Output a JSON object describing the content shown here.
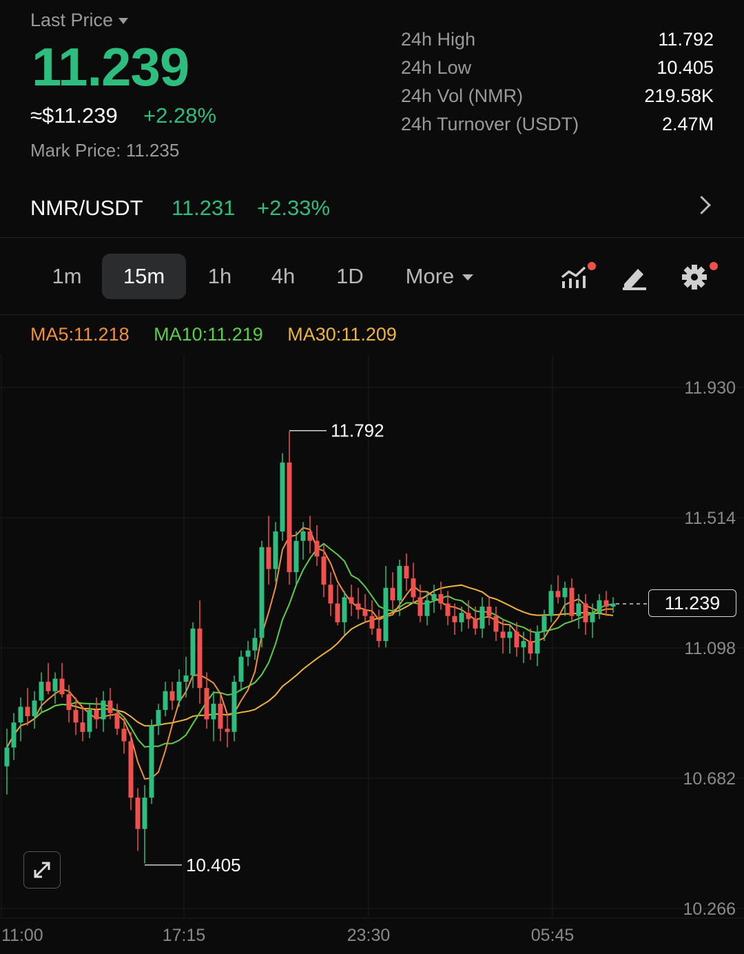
{
  "header": {
    "last_price_label": "Last Price",
    "last_price": "11.239",
    "usd_price": "≈$11.239",
    "change_pct": "+2.28%",
    "mark_price_label": "Mark Price:",
    "mark_price": "11.235"
  },
  "stats": [
    {
      "label": "24h High",
      "value": "11.792"
    },
    {
      "label": "24h Low",
      "value": "10.405"
    },
    {
      "label": "24h Vol (NMR)",
      "value": "219.58K"
    },
    {
      "label": "24h Turnover (USDT)",
      "value": "2.47M"
    }
  ],
  "pair": {
    "name": "NMR/USDT",
    "price": "11.231",
    "change": "+2.33%"
  },
  "timeframes": {
    "items": [
      "1m",
      "15m",
      "1h",
      "4h",
      "1D"
    ],
    "active": "15m",
    "more_label": "More"
  },
  "indicators": {
    "ma5": "MA5:11.218",
    "ma10": "MA10:11.219",
    "ma30": "MA30:11.209"
  },
  "colors": {
    "up": "#2dbd7e",
    "down": "#f0514d",
    "ma5": "#f0913a",
    "ma10": "#5ad04a",
    "ma30": "#f0b43a",
    "background": "#0b0b0b"
  },
  "icons": [
    "chart-indicator-icon",
    "draw-pen-icon",
    "settings-gear-icon",
    "expand-icon",
    "chevron-right-icon"
  ],
  "chart_data": {
    "type": "candlestick",
    "y_ticks": [
      "11.930",
      "11.514",
      "11.098",
      "10.682",
      "10.266"
    ],
    "x_ticks": [
      "11:00",
      "17:15",
      "23:30",
      "05:45"
    ],
    "ylim": [
      10.266,
      11.93
    ],
    "current_price": "11.239",
    "high_marker": "11.792",
    "low_marker": "10.405",
    "candles": [
      [
        10.72,
        10.84,
        10.63,
        10.78
      ],
      [
        10.78,
        10.89,
        10.74,
        10.86
      ],
      [
        10.86,
        10.94,
        10.8,
        10.91
      ],
      [
        10.91,
        10.97,
        10.85,
        10.88
      ],
      [
        10.88,
        10.96,
        10.84,
        10.93
      ],
      [
        10.93,
        11.02,
        10.89,
        10.99
      ],
      [
        10.99,
        11.05,
        10.95,
        10.96
      ],
      [
        10.96,
        11.02,
        10.92,
        11.0
      ],
      [
        11.0,
        11.05,
        10.94,
        10.95
      ],
      [
        10.95,
        10.98,
        10.86,
        10.9
      ],
      [
        10.9,
        10.94,
        10.82,
        10.86
      ],
      [
        10.86,
        10.91,
        10.8,
        10.83
      ],
      [
        10.83,
        10.92,
        10.81,
        10.9
      ],
      [
        10.9,
        10.94,
        10.84,
        10.87
      ],
      [
        10.87,
        10.96,
        10.83,
        10.93
      ],
      [
        10.93,
        10.97,
        10.87,
        10.89
      ],
      [
        10.89,
        10.92,
        10.82,
        10.84
      ],
      [
        10.84,
        10.88,
        10.76,
        10.8
      ],
      [
        10.8,
        10.83,
        10.58,
        10.62
      ],
      [
        10.62,
        10.65,
        10.45,
        10.52
      ],
      [
        10.52,
        10.66,
        10.41,
        10.62
      ],
      [
        10.62,
        10.87,
        10.6,
        10.85
      ],
      [
        10.85,
        10.92,
        10.82,
        10.9
      ],
      [
        10.9,
        10.99,
        10.88,
        10.96
      ],
      [
        10.96,
        10.99,
        10.9,
        10.93
      ],
      [
        10.93,
        11.03,
        10.91,
        10.99
      ],
      [
        10.99,
        11.07,
        10.94,
        11.01
      ],
      [
        11.01,
        11.18,
        10.97,
        11.16
      ],
      [
        11.16,
        11.25,
        10.92,
        10.97
      ],
      [
        10.97,
        11.02,
        10.84,
        10.87
      ],
      [
        10.87,
        10.96,
        10.8,
        10.92
      ],
      [
        10.92,
        10.95,
        10.8,
        10.84
      ],
      [
        10.84,
        10.89,
        10.78,
        10.83
      ],
      [
        10.83,
        11.01,
        10.8,
        10.99
      ],
      [
        10.99,
        11.09,
        10.96,
        11.07
      ],
      [
        11.07,
        11.12,
        11.04,
        11.09
      ],
      [
        11.09,
        11.16,
        11.06,
        11.13
      ],
      [
        11.13,
        11.44,
        11.1,
        11.42
      ],
      [
        11.42,
        11.52,
        11.3,
        11.35
      ],
      [
        11.35,
        11.5,
        11.31,
        11.47
      ],
      [
        11.47,
        11.72,
        11.44,
        11.69
      ],
      [
        11.69,
        11.79,
        11.3,
        11.34
      ],
      [
        11.34,
        11.47,
        11.3,
        11.44
      ],
      [
        11.44,
        11.5,
        11.38,
        11.47
      ],
      [
        11.47,
        11.52,
        11.4,
        11.44
      ],
      [
        11.44,
        11.49,
        11.36,
        11.39
      ],
      [
        11.39,
        11.43,
        11.26,
        11.3
      ],
      [
        11.3,
        11.34,
        11.2,
        11.24
      ],
      [
        11.24,
        11.3,
        11.17,
        11.18
      ],
      [
        11.18,
        11.28,
        11.14,
        11.26
      ],
      [
        11.26,
        11.3,
        11.2,
        11.24
      ],
      [
        11.24,
        11.29,
        11.19,
        11.22
      ],
      [
        11.22,
        11.27,
        11.18,
        11.2
      ],
      [
        11.2,
        11.25,
        11.14,
        11.16
      ],
      [
        11.16,
        11.22,
        11.1,
        11.12
      ],
      [
        11.12,
        11.36,
        11.1,
        11.29
      ],
      [
        11.29,
        11.34,
        11.22,
        11.25
      ],
      [
        11.25,
        11.38,
        11.2,
        11.36
      ],
      [
        11.36,
        11.4,
        11.28,
        11.32
      ],
      [
        11.32,
        11.37,
        11.24,
        11.26
      ],
      [
        11.26,
        11.3,
        11.18,
        11.2
      ],
      [
        11.2,
        11.28,
        11.17,
        11.25
      ],
      [
        11.25,
        11.3,
        11.21,
        11.27
      ],
      [
        11.27,
        11.31,
        11.22,
        11.24
      ],
      [
        11.24,
        11.28,
        11.17,
        11.2
      ],
      [
        11.2,
        11.24,
        11.14,
        11.18
      ],
      [
        11.18,
        11.23,
        11.15,
        11.21
      ],
      [
        11.21,
        11.25,
        11.16,
        11.19
      ],
      [
        11.19,
        11.23,
        11.14,
        11.16
      ],
      [
        11.16,
        11.26,
        11.13,
        11.23
      ],
      [
        11.23,
        11.26,
        11.17,
        11.2
      ],
      [
        11.2,
        11.23,
        11.12,
        11.15
      ],
      [
        11.15,
        11.19,
        11.08,
        11.13
      ],
      [
        11.13,
        11.17,
        11.08,
        11.15
      ],
      [
        11.15,
        11.18,
        11.07,
        11.1
      ],
      [
        11.1,
        11.15,
        11.05,
        11.12
      ],
      [
        11.12,
        11.16,
        11.06,
        11.08
      ],
      [
        11.08,
        11.17,
        11.04,
        11.15
      ],
      [
        11.15,
        11.22,
        11.12,
        11.2
      ],
      [
        11.2,
        11.3,
        11.18,
        11.28
      ],
      [
        11.28,
        11.33,
        11.24,
        11.26
      ],
      [
        11.26,
        11.31,
        11.2,
        11.29
      ],
      [
        11.29,
        11.32,
        11.18,
        11.2
      ],
      [
        11.2,
        11.27,
        11.16,
        11.24
      ],
      [
        11.24,
        11.27,
        11.14,
        11.18
      ],
      [
        11.18,
        11.24,
        11.13,
        11.21
      ],
      [
        11.21,
        11.27,
        11.19,
        11.25
      ],
      [
        11.25,
        11.28,
        11.2,
        11.23
      ],
      [
        11.23,
        11.26,
        11.21,
        11.24
      ]
    ]
  }
}
